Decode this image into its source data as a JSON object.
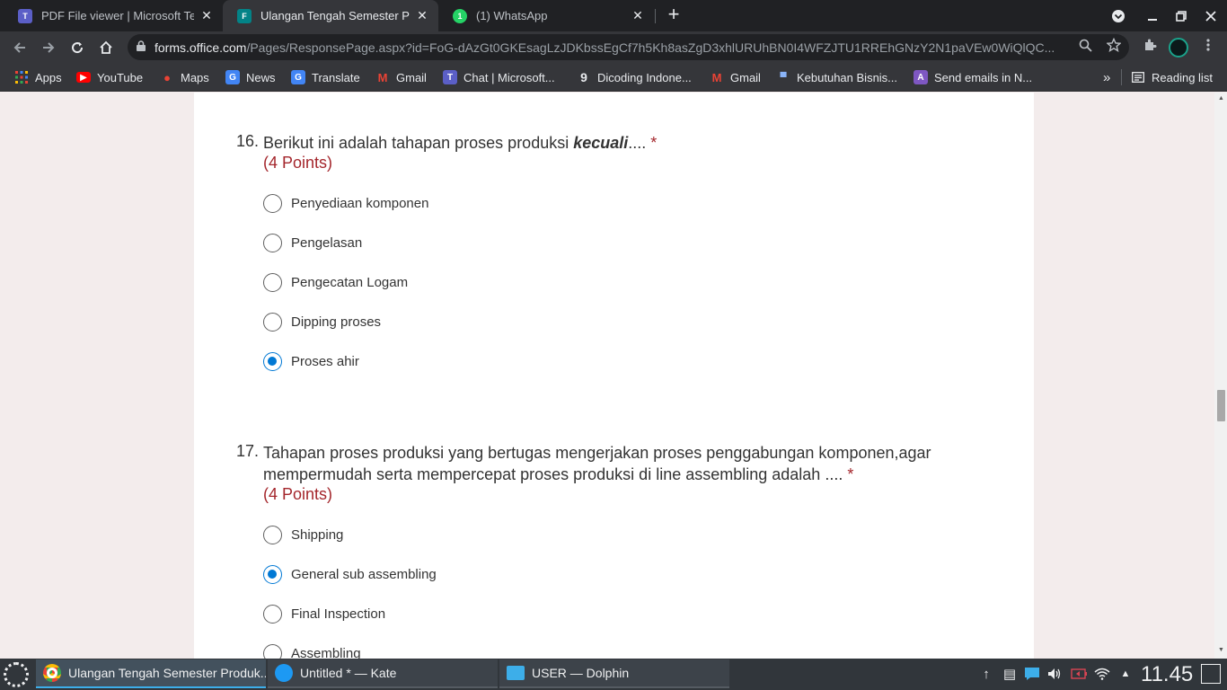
{
  "tabs": [
    {
      "title": "PDF File viewer | Microsoft Te",
      "icon": "teams-icon",
      "icon_color": "#5b5fc7",
      "active": false
    },
    {
      "title": "Ulangan Tengah Semester Pr",
      "icon": "forms-icon",
      "icon_color": "#038387",
      "active": true
    },
    {
      "title": "(1) WhatsApp",
      "icon": "whatsapp-icon",
      "icon_color": "#25d366",
      "active": false
    }
  ],
  "tab_close": "✕",
  "newtab": "+",
  "toolbar": {
    "host": "forms.office.com",
    "path": "/Pages/ResponsePage.aspx?id=FoG-dAzGt0GKEsagLzJDKbssEgCf7h5Kh8asZgD3xhlURUhBN0I4WFZJTU1RREhGNzY2N1paVEw0WiQlQC..."
  },
  "bookmarks": [
    {
      "label": "Apps",
      "icon": "apps-grid-icon"
    },
    {
      "label": "YouTube",
      "icon": "youtube-icon"
    },
    {
      "label": "Maps",
      "icon": "maps-icon"
    },
    {
      "label": "News",
      "icon": "news-icon"
    },
    {
      "label": "Translate",
      "icon": "translate-icon"
    },
    {
      "label": "Gmail",
      "icon": "gmail-icon"
    },
    {
      "label": "Chat | Microsoft...",
      "icon": "teams-icon"
    },
    {
      "label": "Dicoding Indone...",
      "icon": "dicoding-icon"
    },
    {
      "label": "Gmail",
      "icon": "gmail-icon"
    },
    {
      "label": "Kebutuhan Bisnis...",
      "icon": "bookmark-icon"
    },
    {
      "label": "Send emails in N...",
      "icon": "bookmark-icon"
    }
  ],
  "bookmarks_more": "»",
  "reading_list": "Reading list",
  "form": {
    "q16": {
      "number": "16.",
      "text_before": "Berikut ini adalah tahapan proses produksi ",
      "text_emph": "kecuali",
      "text_after": ".... ",
      "required_mark": "*",
      "points": "(4 Points)",
      "options": [
        "Penyediaan komponen",
        "Pengelasan",
        "Pengecatan Logam",
        "Dipping proses",
        "Proses ahir"
      ],
      "selected_index": 4
    },
    "q17": {
      "number": "17.",
      "text_line1": "Tahapan proses produksi yang bertugas mengerjakan proses penggabungan komponen,agar",
      "text_line2": "mempermudah serta mempercepat proses produksi di line assembling adalah .... ",
      "required_mark": "*",
      "points": "(4 Points)",
      "options": [
        "Shipping",
        "General sub assembling",
        "Final Inspection",
        "Assembling"
      ],
      "selected_index": 1
    }
  },
  "taskbar": {
    "tasks": [
      {
        "label": "Ulangan Tengah Semester Produk...",
        "icon": "chrome-icon",
        "active": true
      },
      {
        "label": "Untitled * — Kate",
        "icon": "kate-icon",
        "active": false
      },
      {
        "label": "USER — Dolphin",
        "icon": "dolphin-icon",
        "active": false
      }
    ],
    "clock": "11.45"
  },
  "colors": {
    "accent": "#0078d4",
    "required": "#a4262c",
    "titlebar": "#202124",
    "toolbar": "#35363a",
    "page_bg": "#f3ecec",
    "taskbar": "#31363b"
  }
}
